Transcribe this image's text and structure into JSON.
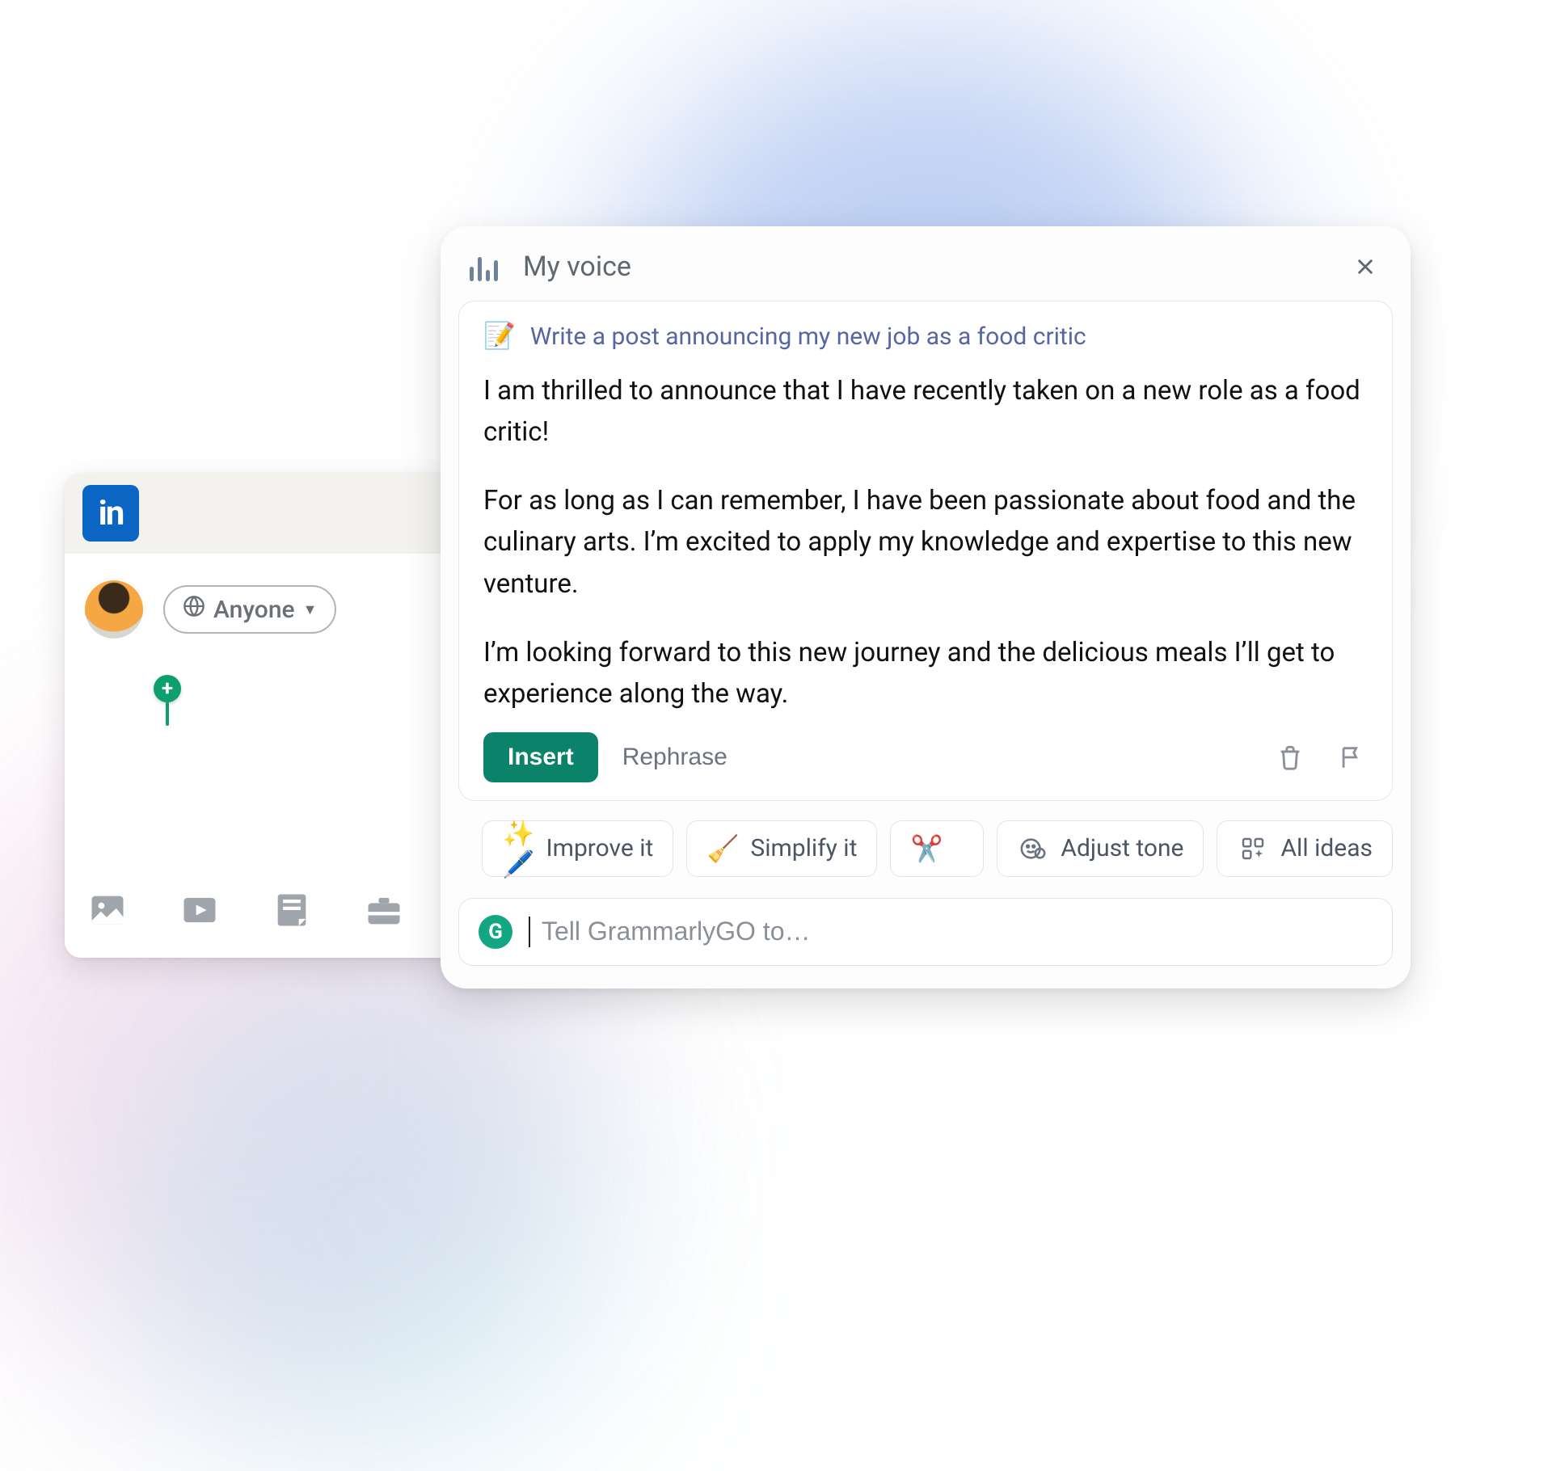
{
  "linkedin": {
    "logo_text": "in",
    "audience_label": "Anyone",
    "toolbar_icons": [
      "image",
      "video",
      "document",
      "briefcase"
    ]
  },
  "grammarly": {
    "header_title": "My voice",
    "prompt": "Write a post announcing my new job as a food critic",
    "generated_paragraphs": [
      "I am thrilled to announce that I have recently taken on a new role as a food critic!",
      "For as long as I can remember, I have been passionate about food and the culinary arts. I’m excited to apply my knowledge and expertise to this new venture.",
      "I’m looking forward to this new journey and the delicious meals I’ll get to experience along the way."
    ],
    "actions": {
      "insert": "Insert",
      "rephrase": "Rephrase"
    },
    "chips": {
      "improve": "Improve it",
      "simplify": "Simplify it",
      "shorten": "",
      "adjust_tone": "Adjust tone",
      "all_ideas": "All ideas"
    },
    "input_placeholder": "Tell GrammarlyGO to…",
    "input_value": ""
  }
}
